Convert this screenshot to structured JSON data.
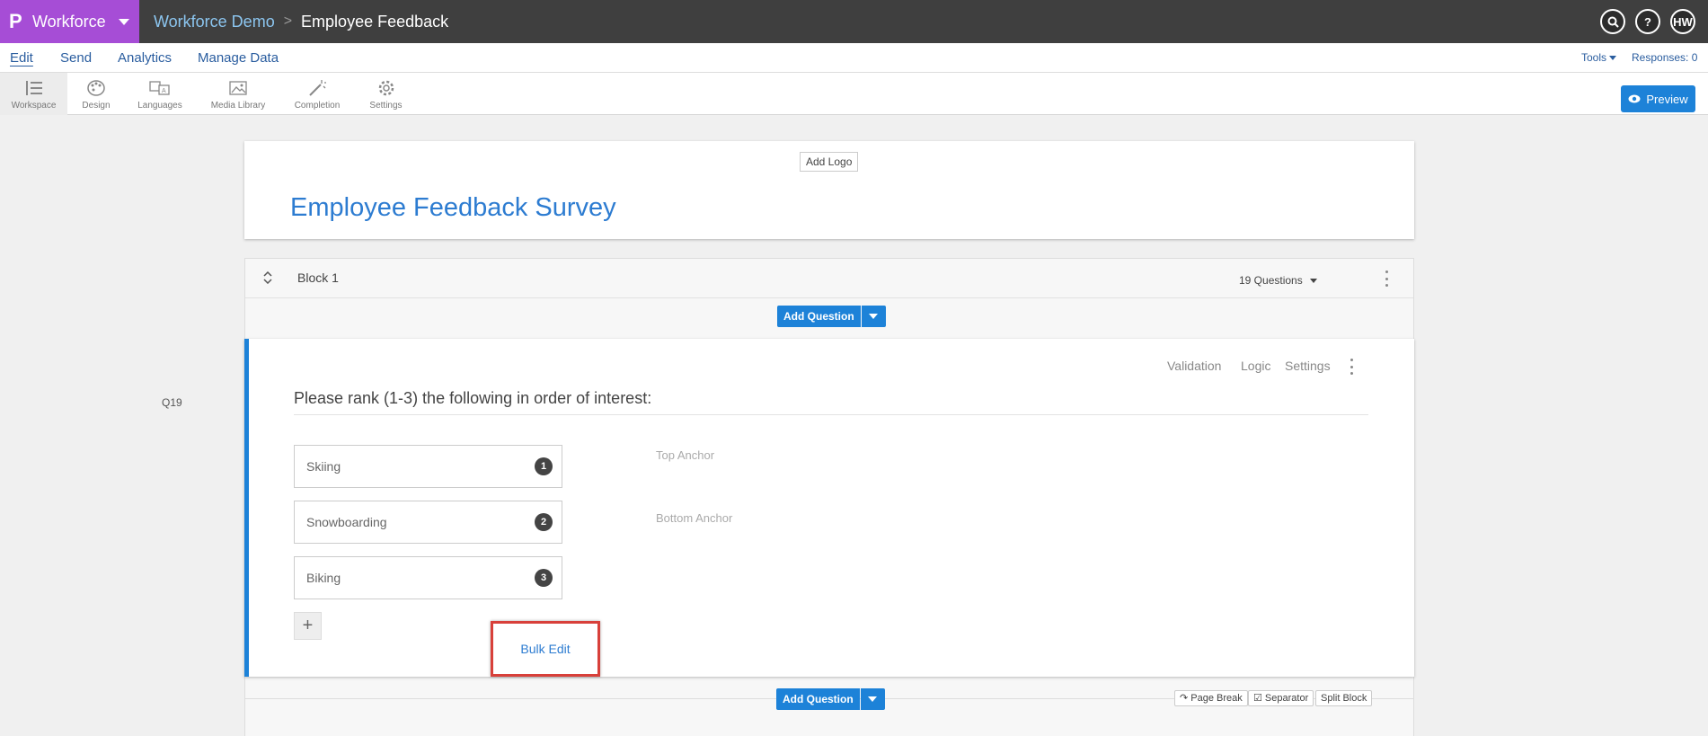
{
  "brand": {
    "name": "Workforce"
  },
  "breadcrumb": {
    "project": "Workforce Demo",
    "separator": ">",
    "survey": "Employee Feedback"
  },
  "top_icons": {
    "search": "search-icon",
    "help": "?",
    "user_initials": "HW"
  },
  "menu": {
    "items": [
      "Edit",
      "Send",
      "Analytics",
      "Manage Data"
    ],
    "tools_label": "Tools",
    "responses_label": "Responses: 0"
  },
  "toolbar": {
    "items": [
      "Workspace",
      "Design",
      "Languages",
      "Media Library",
      "Completion",
      "Settings"
    ],
    "preview_label": "Preview"
  },
  "header": {
    "add_logo_label": "Add Logo",
    "title": "Employee Feedback Survey"
  },
  "block": {
    "name": "Block 1",
    "question_count": "19 Questions",
    "add_question_label": "Add Question"
  },
  "question": {
    "label": "Q19",
    "actions": [
      "Validation",
      "Logic",
      "Settings"
    ],
    "text": "Please rank (1-3) the following in order of interest:",
    "choices": [
      {
        "text": "Skiing",
        "rank": "1"
      },
      {
        "text": "Snowboarding",
        "rank": "2"
      },
      {
        "text": "Biking",
        "rank": "3"
      }
    ],
    "top_anchor": "Top Anchor",
    "bottom_anchor": "Bottom Anchor",
    "add_choice": "+",
    "bulk_edit_label": "Bulk Edit"
  },
  "bottom": {
    "add_question_label": "Add Question",
    "page_break_label": "Page Break",
    "separator_label": "Separator",
    "split_block_label": "Split Block"
  },
  "colors": {
    "brand": "#a64dd6",
    "accent": "#1d82d8",
    "highlight": "#d8403a",
    "topbar": "#3f3f3f"
  }
}
